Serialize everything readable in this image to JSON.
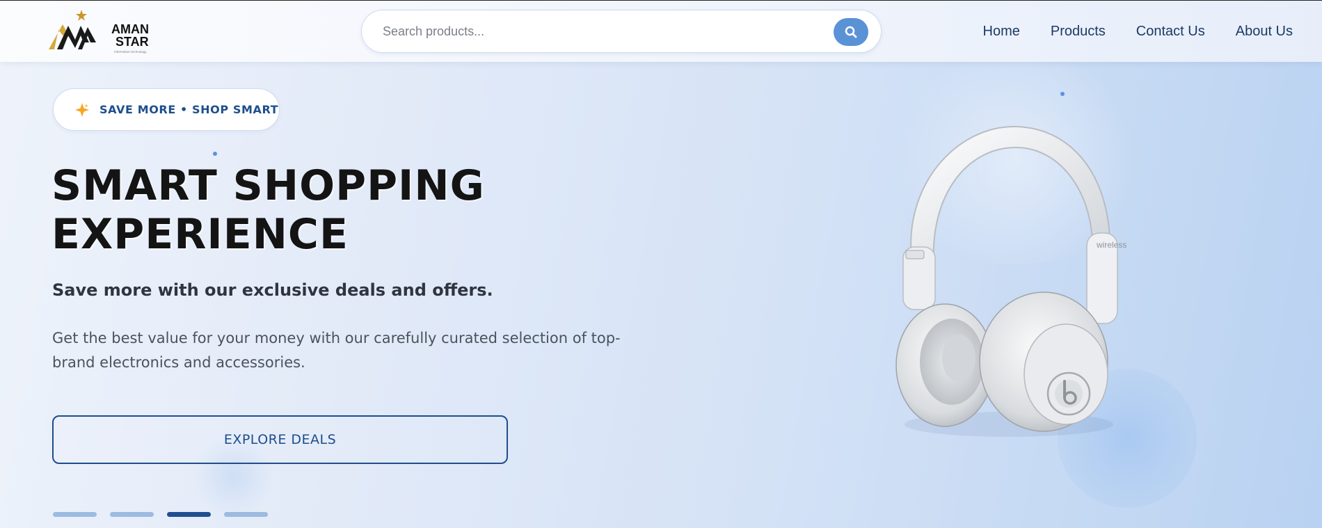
{
  "brand": {
    "name_line1": "AMAN",
    "name_line2": "STAR",
    "tagline": "information technology"
  },
  "search": {
    "placeholder": "Search products...",
    "icon": "search-icon"
  },
  "nav": {
    "items": [
      {
        "label": "Home"
      },
      {
        "label": "Products"
      },
      {
        "label": "Contact Us"
      },
      {
        "label": "About Us"
      }
    ]
  },
  "hero": {
    "badge": {
      "icon": "sparkle-icon",
      "label": "SAVE MORE • SHOP SMART"
    },
    "title_line1": "SMART SHOPPING",
    "title_line2": "EXPERIENCE",
    "subtitle": "Save more with our exclusive deals and offers.",
    "description": "Get the best value for your money with our carefully curated selection of top-brand electronics and accessories.",
    "cta_label": "EXPLORE DEALS",
    "slides": {
      "count": 4,
      "active_index": 2
    },
    "product": {
      "image": "white wireless headphones",
      "imprint": "wireless"
    }
  },
  "colors": {
    "accent": "#5a92d6",
    "brand_blue": "#1e4d8b",
    "title": "#141414",
    "logo_gold": "#d4a93a"
  }
}
